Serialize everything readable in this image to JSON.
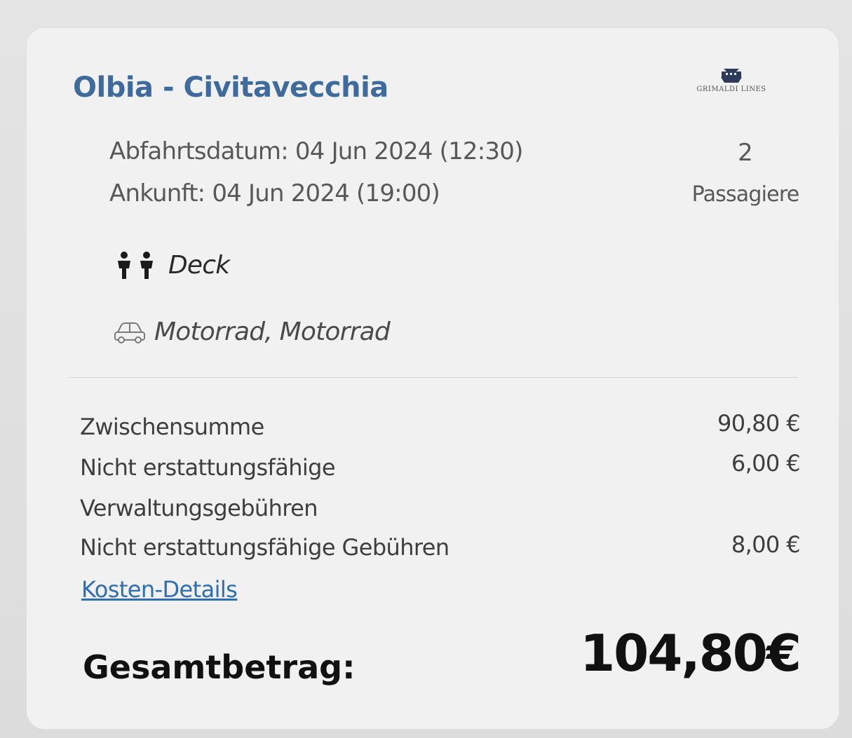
{
  "route": {
    "title": "Olbia - Civitavecchia",
    "carrier_logo_text": "GRIMALDI LINES"
  },
  "journey": {
    "departure": "Abfahrtsdatum: 04 Jun 2024 (12:30)",
    "arrival": "Ankunft: 04 Jun 2024 (19:00)",
    "passenger_count": "2",
    "passenger_label": "Passagiere"
  },
  "accommodation": {
    "icon": "people-icon",
    "label": "Deck"
  },
  "vehicle": {
    "icon": "car-icon",
    "label": "Motorrad, Motorrad"
  },
  "costs": {
    "subtotal_label": "Zwischensumme",
    "subtotal_value": "90,80 €",
    "admin_fee_label_line1": "Nicht erstattungsfähige",
    "admin_fee_label_line2": "Verwaltungsgebühren",
    "admin_fee_value": "6,00 €",
    "fees_label": "Nicht erstattungsfähige Gebühren",
    "fees_value": "8,00 €",
    "details_link": "Kosten-Details"
  },
  "total": {
    "label": "Gesamtbetrag:",
    "value": "104,80€"
  },
  "colors": {
    "title": "#3f6b9c",
    "link": "#2f6fb0",
    "text": "#3e3e3e"
  }
}
